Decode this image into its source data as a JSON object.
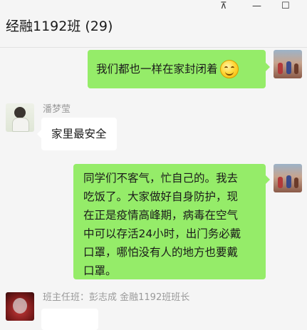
{
  "window": {
    "chat_title": "经融1192班 (29)",
    "controls": {
      "pin": "⊼",
      "minimize": "—",
      "maximize": "☐"
    }
  },
  "messages": [
    {
      "from": "self",
      "text": "我们都也一样在家封闭着",
      "emoji": "smile-emoji"
    },
    {
      "from": "other",
      "sender": "潘梦莹",
      "text": "家里最安全"
    },
    {
      "from": "self",
      "lines": [
        "同学们不客气，忙自己的。我去",
        "吃饭了。大家做好自身防护，现",
        "在正是疫情高峰期，病毒在空气",
        "中可以存活24小时，出门务必戴",
        "口罩，哪怕没有人的地方也要戴",
        "口罩。"
      ]
    },
    {
      "from": "other",
      "sender": "班主任班：彭志成 金融1192班班长"
    }
  ],
  "colors": {
    "self_bubble": "#95ec69",
    "other_bubble": "#ffffff",
    "background": "#f5f5f5"
  }
}
